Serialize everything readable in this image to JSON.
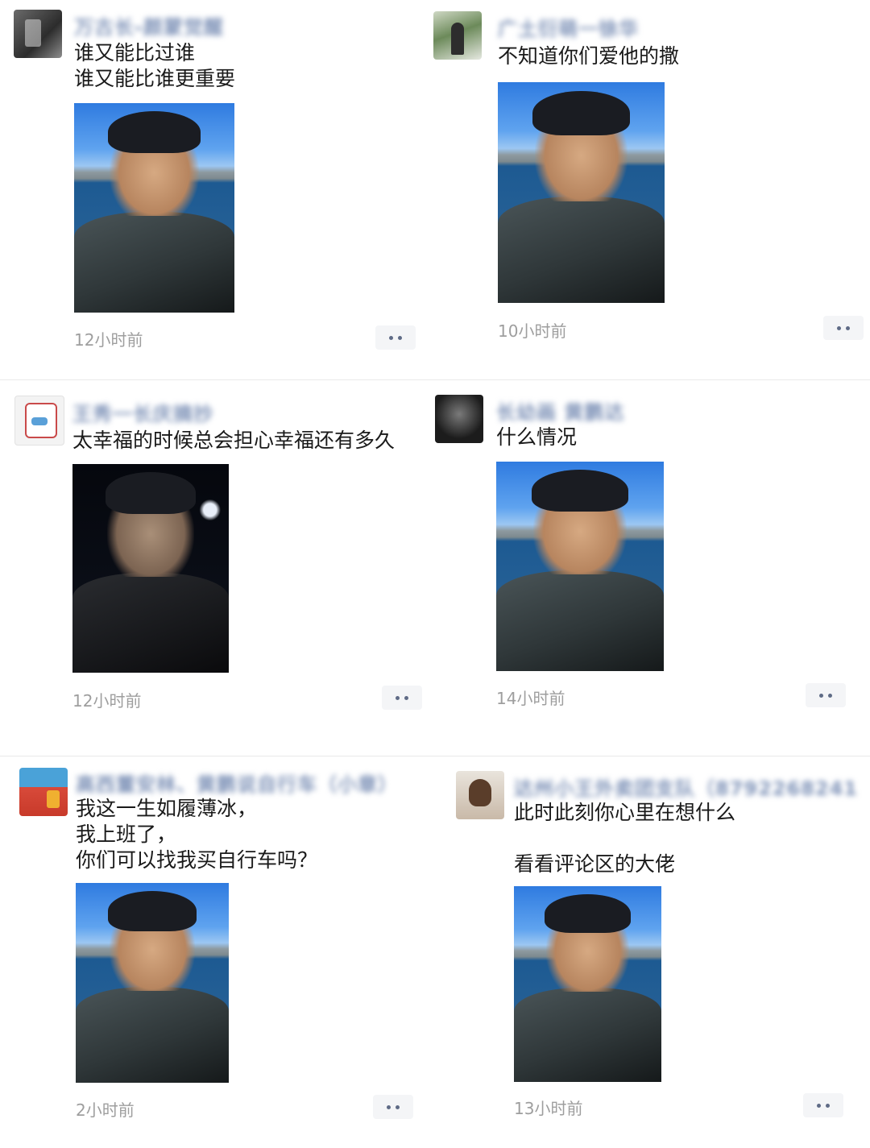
{
  "posts": [
    {
      "name": "万古长-颜蒙觉醒",
      "lines": "谁又能比过谁\n谁又能比谁更重要",
      "time": "12小时前",
      "photo": "selfie-lake"
    },
    {
      "name": "广土衍萌一徐华",
      "lines": "不知道你们爱他的撒",
      "time": "10小时前",
      "photo": "selfie-lake"
    },
    {
      "name": "王秀一长庆摘抄",
      "lines": "太幸福的时候总会担心幸福还有多久",
      "time": "12小时前",
      "photo": "selfie-night"
    },
    {
      "name": "长幼画 黄鹏达",
      "lines": "什么情况",
      "time": "14小时前",
      "photo": "selfie-lake"
    },
    {
      "name": "高西董安林、黄鹏说自行车（小章）",
      "lines": "我这一生如履薄冰，\n我上班了，\n你们可以找我买自行车吗？",
      "time": "2小时前",
      "photo": "selfie-lake"
    },
    {
      "name": "达州小王外卖团支队（8792268241",
      "lines": "此时此刻你心里在想什么\n\n看看评论区的大佬",
      "time": "13小时前",
      "photo": "selfie-lake"
    }
  ],
  "icons": {
    "more": "more-dots-icon"
  },
  "colors": {
    "name": "#7f93b8",
    "time": "#9e9e9e",
    "divider": "#e9e9e9"
  }
}
